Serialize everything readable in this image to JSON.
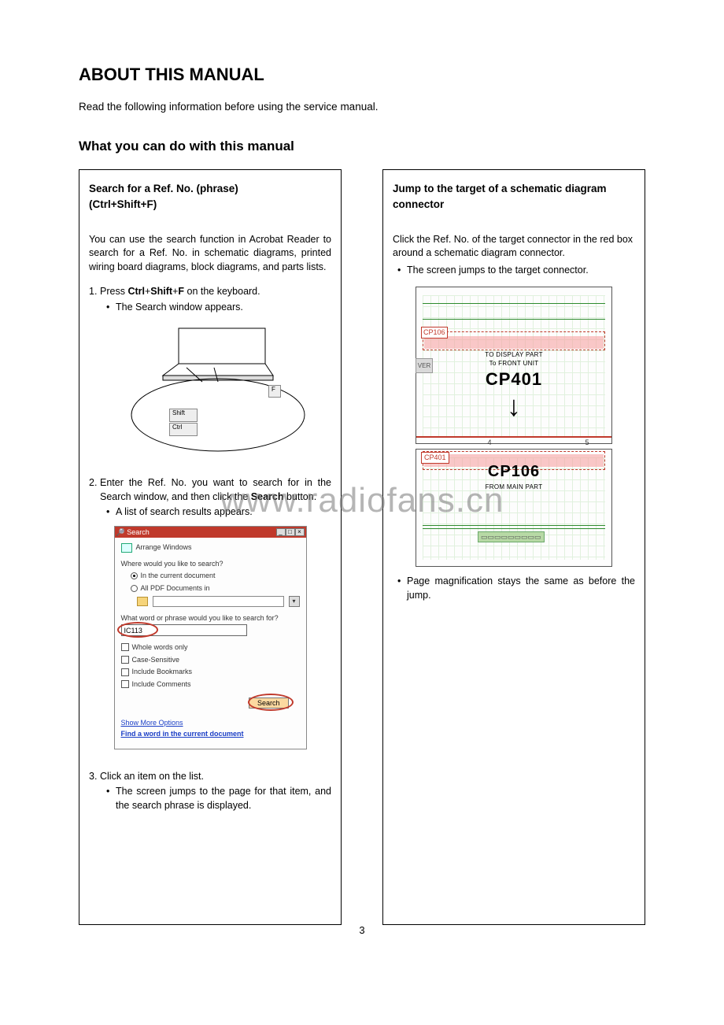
{
  "page": {
    "title": "ABOUT THIS MANUAL",
    "intro": "Read the following information before using the service manual.",
    "subtitle": "What you can do with this manual",
    "page_number": "3",
    "watermark": "www.radiofans.cn"
  },
  "left": {
    "heading_line1": "Search for a Ref. No. (phrase)",
    "heading_line2": "(Ctrl+Shift+F)",
    "para": "You can use the search function in Acrobat Reader to search for a Ref. No. in schematic diagrams, printed wiring board diagrams, block diagrams, and parts lists.",
    "step1_text": "Press Ctrl+Shift+F on the keyboard.",
    "step1_text_prefix": "Press ",
    "step1_bold1": "Ctrl",
    "step1_plus1": "+",
    "step1_bold2": "Shift",
    "step1_plus2": "+",
    "step1_bold3": "F",
    "step1_suffix": " on the keyboard.",
    "step1_bullet": "The Search window appears.",
    "key_f": "F",
    "key_shift": "Shift",
    "key_ctrl": "Ctrl",
    "step2_prefix": "Enter the Ref. No. you want to search for in the Search window, and then click the ",
    "step2_bold": "Search",
    "step2_suffix": " button.",
    "step2_bullet": "A list of search results appears.",
    "step3_text": "Click an item on the list.",
    "step3_bullet": "The screen jumps to the page for that item, and the search phrase is displayed."
  },
  "search_window": {
    "title": "Search",
    "arrange": "Arrange Windows",
    "where_label": "Where would you like to search?",
    "radio_current": "In the current document",
    "radio_allpdf": "All PDF Documents in",
    "phrase_label": "What word or phrase would you like to search for?",
    "input_value": "IC113",
    "opt_whole": "Whole words only",
    "opt_case": "Case-Sensitive",
    "opt_bookmarks": "Include Bookmarks",
    "opt_comments": "Include Comments",
    "button": "Search",
    "link_more": "Show More Options",
    "link_find": "Find a word in the current document"
  },
  "right": {
    "heading": "Jump to the target of a schematic diagram connector",
    "para": "Click the Ref. No. of the target connector in the red box around a schematic diagram connector.",
    "bullet1": "The screen jumps to the target connector.",
    "bullet2": "Page magnification stays the same as before the jump."
  },
  "schematic": {
    "cp106": "CP106",
    "to_display": "TO DISPLAY PART",
    "to_front": "To FRONT UNIT",
    "cp401": "CP401",
    "from_main": "FROM MAIN PART",
    "ver_tab": "VER",
    "ruler_4": "4",
    "ruler_5": "5"
  }
}
